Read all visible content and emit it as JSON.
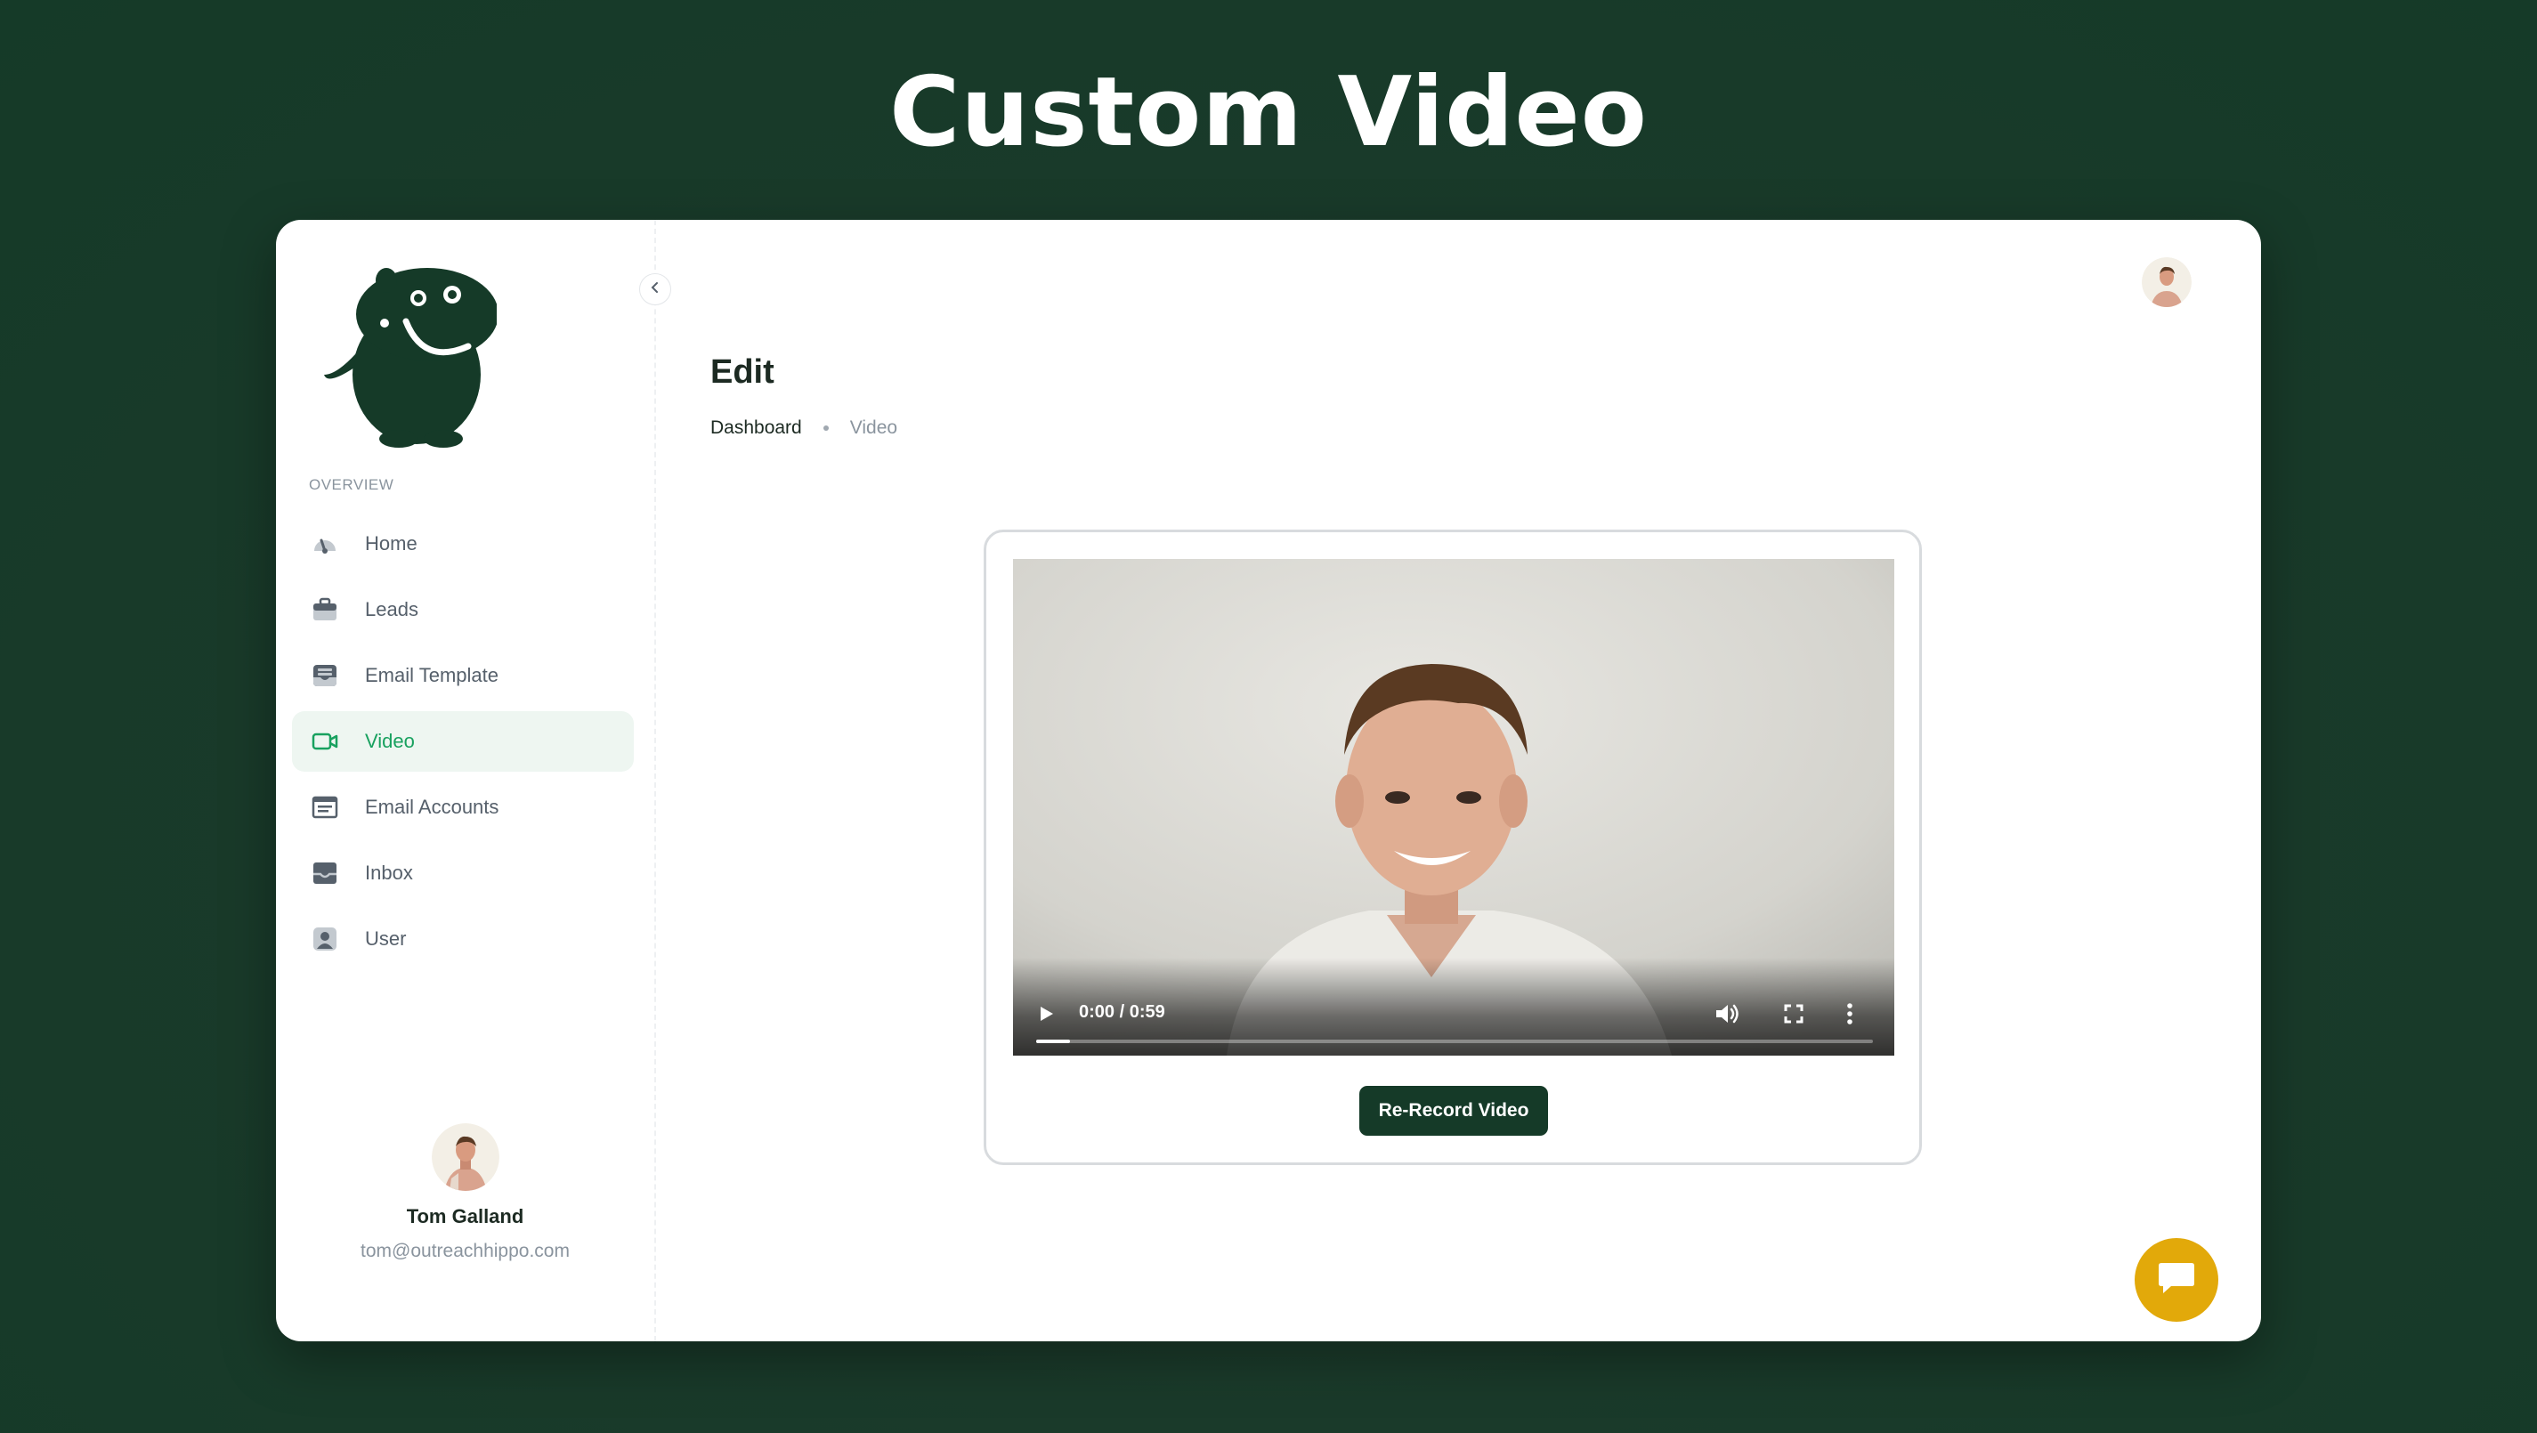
{
  "hero": {
    "title": "Custom Video"
  },
  "sidebar": {
    "section_label": "OVERVIEW",
    "items": [
      {
        "label": "Home",
        "icon": "gauge-icon",
        "active": false
      },
      {
        "label": "Leads",
        "icon": "briefcase-icon",
        "active": false
      },
      {
        "label": "Email Template",
        "icon": "inbox-tray-icon",
        "active": false
      },
      {
        "label": "Video",
        "icon": "video-camera-icon",
        "active": true
      },
      {
        "label": "Email Accounts",
        "icon": "card-list-icon",
        "active": false
      },
      {
        "label": "Inbox",
        "icon": "inbox-icon",
        "active": false
      },
      {
        "label": "User",
        "icon": "user-icon",
        "active": false
      }
    ],
    "profile": {
      "name": "Tom Galland",
      "email": "tom@outreachhippo.com"
    }
  },
  "main": {
    "title": "Edit",
    "breadcrumb": {
      "home": "Dashboard",
      "current": "Video"
    }
  },
  "video": {
    "time": "0:00 / 0:59",
    "progress": 0.04,
    "rerecord_label": "Re-Record Video"
  },
  "colors": {
    "brand_dark": "#153a28",
    "accent_green": "#18a15f",
    "chat_yellow": "#e2a90a"
  }
}
